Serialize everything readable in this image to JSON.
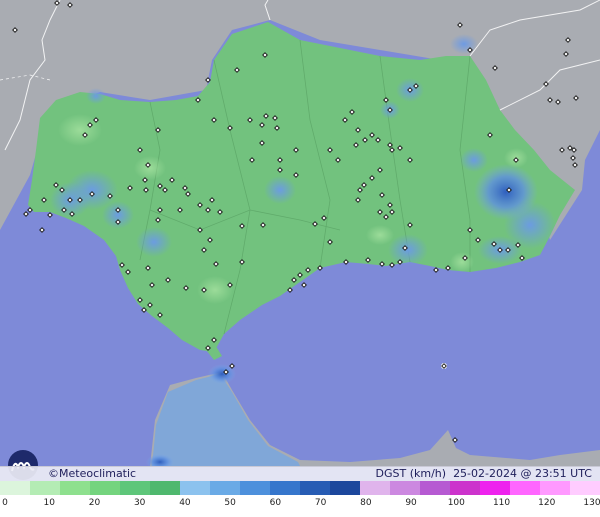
{
  "brand": {
    "name": "©Meteoclimatic",
    "logo_icon": "meteoclimatic-logo-icon"
  },
  "info": {
    "variable": "DGST (km/h)",
    "timestamp": "25-02-2024 @ 23:51 UTC"
  },
  "colors": {
    "sea": "#7e8ad8",
    "land_neighbors": "#a9acb2",
    "land_main": "#72c27e",
    "gust_hotspot": "#6a9ae0",
    "gust_strong": "#3f6fc8"
  },
  "legend": {
    "labels": [
      "0",
      "10",
      "20",
      "30",
      "40",
      "50",
      "60",
      "70",
      "80",
      "90",
      "100",
      "110",
      "120",
      "130"
    ],
    "max": 130,
    "colors": [
      "#dcf5dc",
      "#b4ecb4",
      "#8ee08e",
      "#74d47e",
      "#5ec67a",
      "#4fb86e",
      "#8cc2ee",
      "#6aaae6",
      "#4d90dc",
      "#3676cc",
      "#275cb4",
      "#1c479c",
      "#e0b4ec",
      "#cc88e0",
      "#b65ad2",
      "#cc33cc",
      "#ee22ee",
      "#ff66ff",
      "#ff99ff",
      "#ffccff"
    ]
  },
  "stations": {
    "markers": [
      [
        15,
        30
      ],
      [
        57,
        3
      ],
      [
        70,
        5
      ],
      [
        568,
        40
      ],
      [
        566,
        54
      ],
      [
        546,
        84
      ],
      [
        550,
        100
      ],
      [
        558,
        102
      ],
      [
        576,
        98
      ],
      [
        562,
        150
      ],
      [
        573,
        158
      ],
      [
        575,
        165
      ],
      [
        570,
        148
      ],
      [
        460,
        25
      ],
      [
        495,
        68
      ],
      [
        470,
        50
      ],
      [
        265,
        55
      ],
      [
        237,
        70
      ],
      [
        208,
        80
      ],
      [
        198,
        100
      ],
      [
        214,
        120
      ],
      [
        230,
        128
      ],
      [
        250,
        120
      ],
      [
        262,
        125
      ],
      [
        266,
        116
      ],
      [
        275,
        118
      ],
      [
        277,
        128
      ],
      [
        262,
        143
      ],
      [
        296,
        150
      ],
      [
        280,
        160
      ],
      [
        280,
        170
      ],
      [
        296,
        175
      ],
      [
        252,
        160
      ],
      [
        158,
        130
      ],
      [
        140,
        150
      ],
      [
        148,
        165
      ],
      [
        145,
        180
      ],
      [
        160,
        186
      ],
      [
        172,
        180
      ],
      [
        130,
        188
      ],
      [
        146,
        190
      ],
      [
        165,
        190
      ],
      [
        185,
        188
      ],
      [
        188,
        194
      ],
      [
        160,
        210
      ],
      [
        158,
        220
      ],
      [
        180,
        210
      ],
      [
        200,
        205
      ],
      [
        208,
        210
      ],
      [
        212,
        200
      ],
      [
        220,
        212
      ],
      [
        200,
        230
      ],
      [
        210,
        240
      ],
      [
        204,
        250
      ],
      [
        216,
        264
      ],
      [
        96,
        120
      ],
      [
        90,
        125
      ],
      [
        85,
        135
      ],
      [
        56,
        185
      ],
      [
        62,
        190
      ],
      [
        70,
        200
      ],
      [
        64,
        210
      ],
      [
        72,
        214
      ],
      [
        80,
        200
      ],
      [
        92,
        194
      ],
      [
        110,
        196
      ],
      [
        118,
        210
      ],
      [
        118,
        222
      ],
      [
        44,
        200
      ],
      [
        30,
        210
      ],
      [
        26,
        214
      ],
      [
        330,
        150
      ],
      [
        338,
        160
      ],
      [
        356,
        145
      ],
      [
        365,
        140
      ],
      [
        372,
        135
      ],
      [
        378,
        140
      ],
      [
        390,
        145
      ],
      [
        392,
        150
      ],
      [
        400,
        148
      ],
      [
        410,
        160
      ],
      [
        380,
        170
      ],
      [
        372,
        178
      ],
      [
        364,
        185
      ],
      [
        360,
        190
      ],
      [
        358,
        200
      ],
      [
        382,
        195
      ],
      [
        390,
        205
      ],
      [
        392,
        212
      ],
      [
        386,
        217
      ],
      [
        380,
        212
      ],
      [
        410,
        225
      ],
      [
        405,
        248
      ],
      [
        400,
        262
      ],
      [
        392,
        265
      ],
      [
        382,
        264
      ],
      [
        368,
        260
      ],
      [
        346,
        262
      ],
      [
        320,
        268
      ],
      [
        308,
        270
      ],
      [
        300,
        275
      ],
      [
        294,
        280
      ],
      [
        304,
        285
      ],
      [
        290,
        290
      ],
      [
        242,
        262
      ],
      [
        230,
        285
      ],
      [
        204,
        290
      ],
      [
        186,
        288
      ],
      [
        168,
        280
      ],
      [
        140,
        300
      ],
      [
        144,
        310
      ],
      [
        160,
        315
      ],
      [
        150,
        305
      ],
      [
        214,
        340
      ],
      [
        208,
        348
      ],
      [
        232,
        366
      ],
      [
        226,
        372
      ],
      [
        390,
        110
      ],
      [
        386,
        100
      ],
      [
        410,
        90
      ],
      [
        416,
        86
      ],
      [
        358,
        130
      ],
      [
        345,
        120
      ],
      [
        352,
        112
      ],
      [
        490,
        135
      ],
      [
        509,
        190
      ],
      [
        516,
        160
      ],
      [
        470,
        230
      ],
      [
        478,
        240
      ],
      [
        494,
        244
      ],
      [
        500,
        250
      ],
      [
        508,
        250
      ],
      [
        518,
        245
      ],
      [
        522,
        258
      ],
      [
        465,
        258
      ],
      [
        448,
        268
      ],
      [
        436,
        270
      ],
      [
        122,
        265
      ],
      [
        128,
        272
      ],
      [
        148,
        268
      ],
      [
        152,
        285
      ],
      [
        242,
        226
      ],
      [
        263,
        225
      ],
      [
        315,
        224
      ],
      [
        324,
        218
      ],
      [
        330,
        242
      ],
      [
        455,
        440
      ],
      [
        444,
        366
      ],
      [
        50,
        215
      ],
      [
        42,
        230
      ],
      [
        574,
        150
      ]
    ]
  }
}
